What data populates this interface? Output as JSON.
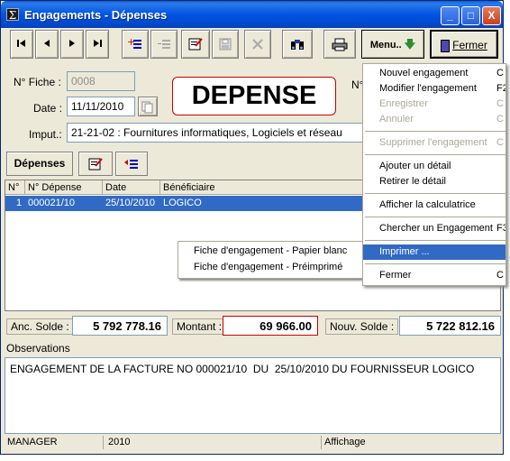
{
  "window": {
    "title": "Engagements - Dépenses",
    "minimize": "_",
    "maximize": "□",
    "close": "X"
  },
  "toolbar": {
    "nav_first": "first-record-icon",
    "nav_prev": "previous-record-icon",
    "nav_next": "next-record-icon",
    "nav_last": "last-record-icon",
    "menu_label": "Menu..",
    "fermer_label": "Fermer"
  },
  "form": {
    "fiche_label": "N° Fiche :",
    "fiche_value": "0008",
    "date_label": "Date :",
    "date_value": "11/11/2010",
    "doc_type": "DEPENSE",
    "n_label": "N°",
    "imput_label": "Imput.:",
    "imput_value": "21-21-02 : Fournitures informatiques, Logiciels et réseau"
  },
  "tabs": {
    "depenses": "Dépenses"
  },
  "grid": {
    "headers": [
      "N°",
      "N° Dépense",
      "Date",
      "Bénéficiaire"
    ],
    "rows": [
      [
        "1",
        "000021/10",
        "25/10/2010",
        "LOGICO"
      ]
    ]
  },
  "context_menu": {
    "items": [
      "Fiche d'engagement - Papier blanc",
      "Fiche d'engagement - Préimprimé"
    ]
  },
  "dropdown": {
    "items": [
      {
        "label": "Nouvel engagement",
        "shortcut": "C"
      },
      {
        "label": "Modifier l'engagement",
        "shortcut": "F2"
      },
      {
        "label": "Enregistrer",
        "shortcut": "C"
      },
      {
        "label": "Annuler",
        "shortcut": "C"
      },
      {
        "label": "Supprimer l'engagement",
        "shortcut": "C"
      },
      {
        "label": "Ajouter un détail",
        "shortcut": ""
      },
      {
        "label": "Retirer le détail",
        "shortcut": ""
      },
      {
        "label": "Afficher la calculatrice",
        "shortcut": ""
      },
      {
        "label": "Chercher un Engagement",
        "shortcut": "F3"
      },
      {
        "label": "Imprimer ...",
        "shortcut": ""
      },
      {
        "label": "Fermer",
        "shortcut": "C"
      }
    ]
  },
  "totals": {
    "anc_label": "Anc. Solde :",
    "anc_value": "5 792 778.16",
    "montant_label": "Montant :",
    "montant_value": "69 966.00",
    "nouv_label": "Nouv. Solde :",
    "nouv_value": "5 722 812.16"
  },
  "observations": {
    "label": "Observations",
    "text": "ENGAGEMENT DE LA FACTURE NO 000021/10  DU  25/10/2010 DU FOURNISSEUR LOGICO"
  },
  "status": {
    "user": "MANAGER",
    "year": "2010",
    "mode": "Affichage"
  }
}
